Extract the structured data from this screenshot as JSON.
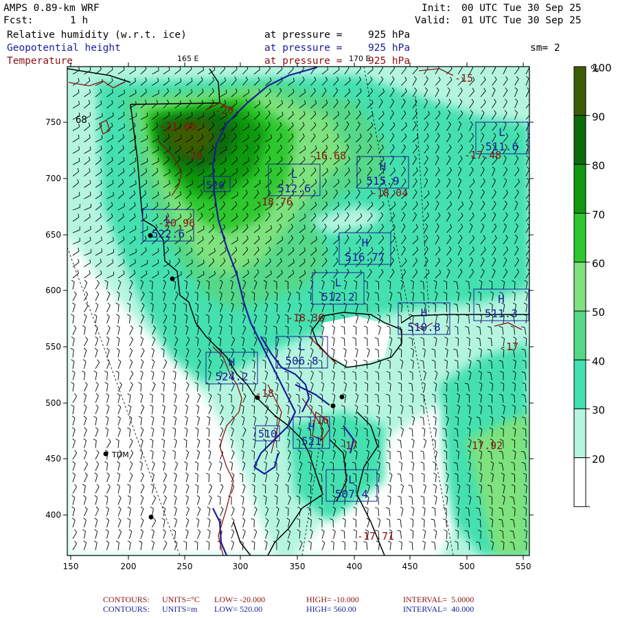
{
  "header": {
    "model": "AMPS 0.89-km WRF",
    "fcst_label": "Fcst:",
    "fcst_value": "1 h",
    "init_label": "Init:",
    "init_value": "00 UTC Tue 30 Sep 25",
    "valid_label": "Valid:",
    "valid_value": "01 UTC Tue 30 Sep 25",
    "fields": [
      {
        "name": "Relative humidity (w.r.t. ice)",
        "pressure_label": "at pressure =",
        "pressure_value": "925 hPa",
        "color": "#000000"
      },
      {
        "name": "Geopotential height",
        "pressure_label": "at pressure =",
        "pressure_value": "925 hPa",
        "color": "#1a1a9a"
      },
      {
        "name": "Temperature",
        "pressure_label": "at pressure =",
        "pressure_value": "925 hPa",
        "color": "#8b1010"
      }
    ],
    "smoothing": "sm= 2",
    "lon_label_165": "165 E",
    "lon_label_170": "170 E"
  },
  "axes": {
    "x_ticks": [
      "150",
      "200",
      "250",
      "300",
      "350",
      "400",
      "450",
      "500",
      "550"
    ],
    "y_ticks": [
      "750",
      "700",
      "650",
      "600",
      "550",
      "500",
      "450",
      "400"
    ]
  },
  "colorbar": {
    "unit": "%",
    "labels": [
      "100",
      "90",
      "80",
      "70",
      "60",
      "50",
      "40",
      "30",
      "20"
    ],
    "colors": [
      "#3d5c06",
      "#0b6b0b",
      "#109810",
      "#2dc82d",
      "#7ee27e",
      "#55d888",
      "#44e0b0",
      "#b5f5e0",
      "#ffffff"
    ]
  },
  "stations": {
    "tdm": "TDM"
  },
  "pressure_centers": [
    {
      "type": "L",
      "value": "511.6"
    },
    {
      "type": "H",
      "value": "515.9"
    },
    {
      "type": "L",
      "value": "512.6"
    },
    {
      "type": "L",
      "value": "522.6"
    },
    {
      "type": "H",
      "value": "516.77"
    },
    {
      "type": "L",
      "value": "512.2"
    },
    {
      "type": "H",
      "value": "510.8"
    },
    {
      "type": "H",
      "value": "511.3"
    },
    {
      "type": "L",
      "value": "506.8"
    },
    {
      "type": "H",
      "value": "524.2"
    },
    {
      "type": "L",
      "value": "510"
    },
    {
      "type": "H",
      "value": "521"
    },
    {
      "type": "L",
      "value": "507.4"
    }
  ],
  "height_contour_label": "520",
  "temp_labels": [
    "-21.06",
    "-20",
    "-20",
    "-16.68",
    "-18.76",
    "-18.04",
    "-20.96",
    "-18.36",
    "-17.48",
    "-17.92",
    "-17.71",
    "-15",
    "-17",
    "-18",
    "-16",
    "-17"
  ],
  "rh_label": "68",
  "footer": {
    "red": {
      "label": "CONTOURS:",
      "units": "UNITS=°C",
      "low": "LOW= -20.000",
      "high": "HIGH= -10.000",
      "interval": "INTERVAL=  5.0000"
    },
    "blue": {
      "label": "CONTOURS:",
      "units": "UNITS=m",
      "low": "LOW= 520.00",
      "high": "HIGH= 560.00",
      "interval": "INTERVAL=  40.000"
    }
  },
  "colors": {
    "red_contour": "#8b1010",
    "blue_contour": "#1a1a9a",
    "frame": "#000000"
  }
}
